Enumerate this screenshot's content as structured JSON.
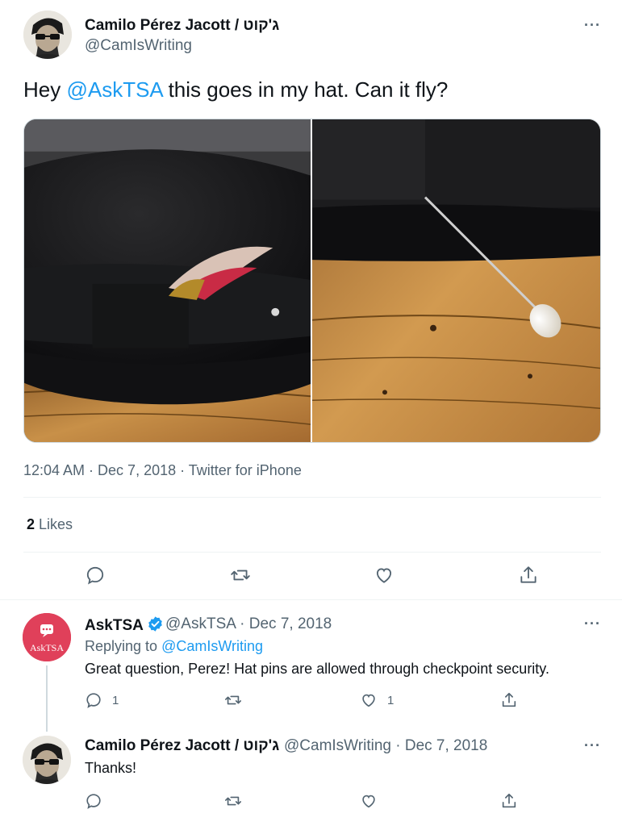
{
  "main_tweet": {
    "author_name": "Camilo Pérez Jacott / ג'קוט",
    "author_handle": "@CamIsWriting",
    "text_before": "Hey ",
    "text_mention": "@AskTSA",
    "text_after": " this goes in my hat. Can it fly?",
    "timestamp": "12:04 AM · Dec 7, 2018 · Twitter for iPhone",
    "likes_count": "2",
    "likes_label": " Likes",
    "media": [
      "hat-with-feather-photo",
      "hat-pin-photo"
    ]
  },
  "reply": {
    "author_name": "AskTSA",
    "author_handle": "@AskTSA",
    "date": " · Dec 7, 2018",
    "avatar_text": "AskTSA",
    "replying_prefix": "Replying to ",
    "replying_handle": "@CamIsWriting",
    "text": "Great question, Perez! Hat pins are allowed through checkpoint security.",
    "reply_count": "1",
    "like_count": "1",
    "verified": true
  },
  "second_reply": {
    "author_name": "Camilo Pérez Jacott / ג'קוט",
    "author_handle": "@CamIsWriting",
    "date": " · Dec 7, 2018",
    "text": "Thanks!"
  },
  "icons": [
    "reply-icon",
    "retweet-icon",
    "like-icon",
    "share-icon",
    "more-icon",
    "verified-icon"
  ],
  "colors": {
    "accent": "#1d9bf0",
    "text": "#0f1419",
    "muted": "#536471",
    "tsa_red": "#e0405a"
  }
}
